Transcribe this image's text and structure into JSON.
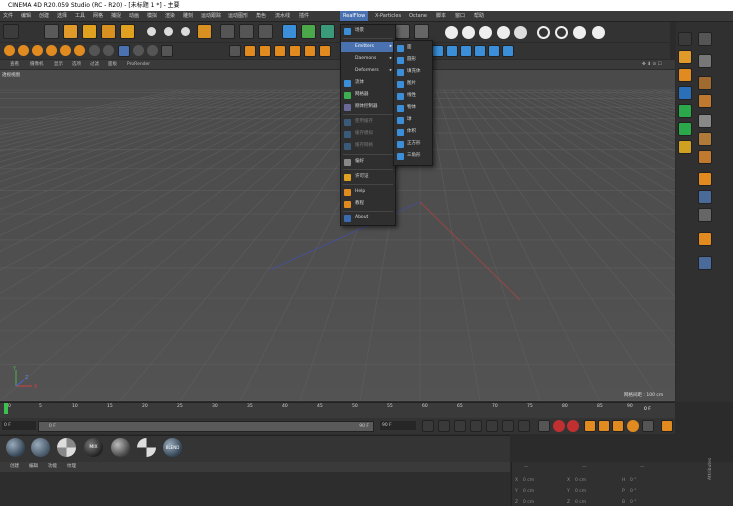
{
  "window": {
    "title": "CINEMA 4D R20.059 Studio (RC - R20) - [未标题 1 *] - 主要"
  },
  "menubar": {
    "items": [
      "文件",
      "编辑",
      "创建",
      "选择",
      "工具",
      "网格",
      "捕捉",
      "动画",
      "模拟",
      "渲染",
      "雕刻",
      "运动跟踪",
      "运动图形",
      "角色",
      "流水线",
      "插件",
      "X-Particles",
      "Octane",
      "脚本",
      "窗口",
      "帮助"
    ],
    "active": "RealFlow"
  },
  "viewport": {
    "menu": [
      "查看",
      "摄像机",
      "显示",
      "选项",
      "过滤",
      "面板",
      "ProRender"
    ],
    "name": "透视视图",
    "grid_spacing": "网格间距 : 100 cm",
    "axis_x": "X",
    "axis_y": "Y",
    "axis_z": "Z"
  },
  "realflow_menu": {
    "items": [
      {
        "label": "场景",
        "enabled": true
      },
      {
        "label": "Emitters",
        "enabled": true,
        "submenu": true,
        "selected": true
      },
      {
        "label": "Daemons",
        "enabled": true,
        "submenu": true
      },
      {
        "label": "Deformers",
        "enabled": true,
        "submenu": true
      },
      {
        "label": "流体",
        "enabled": true
      },
      {
        "label": "网格器",
        "enabled": true
      },
      {
        "label": "刚体控制器",
        "enabled": true
      },
      {
        "label": "使用缓存",
        "enabled": false
      },
      {
        "label": "缓存模拟",
        "enabled": false
      },
      {
        "label": "缓存网格",
        "enabled": false
      },
      {
        "label": "偏好",
        "enabled": true
      },
      {
        "label": "许可证",
        "enabled": true
      },
      {
        "label": "Help",
        "enabled": true
      },
      {
        "label": "教程",
        "enabled": true
      },
      {
        "label": "About",
        "enabled": true
      }
    ]
  },
  "emitters_submenu": {
    "items": [
      "面",
      "圆形",
      "填充体",
      "图片",
      "线性",
      "物体",
      "球",
      "体积",
      "正方形",
      "三角形"
    ]
  },
  "timeline": {
    "ticks": [
      "0",
      "5",
      "10",
      "15",
      "20",
      "25",
      "30",
      "35",
      "40",
      "45",
      "50",
      "55",
      "60",
      "65",
      "70",
      "75",
      "80",
      "85",
      "90"
    ],
    "current_frame": "0 F"
  },
  "transport": {
    "start_field": "0 F",
    "preview_start": "0 F",
    "preview_end": "90 F",
    "end_field": "90 F"
  },
  "materials": {
    "labels": [
      "MIX",
      "BLEND"
    ]
  },
  "bottom_menu": [
    "创建",
    "编辑",
    "功能",
    "纹理"
  ],
  "coords": {
    "header": [
      "—",
      "—",
      "—"
    ],
    "rows": [
      {
        "axis": "X",
        "pos": "0 cm",
        "size_axis": "X",
        "size": "0 cm",
        "rot_axis": "H",
        "rot": "0 °"
      },
      {
        "axis": "Y",
        "pos": "0 cm",
        "size_axis": "Y",
        "size": "0 cm",
        "rot_axis": "P",
        "rot": "0 °"
      },
      {
        "axis": "Z",
        "pos": "0 cm",
        "size_axis": "Z",
        "size": "0 cm",
        "rot_axis": "B",
        "rot": "0 °"
      }
    ]
  },
  "side_tab": "Attributes"
}
